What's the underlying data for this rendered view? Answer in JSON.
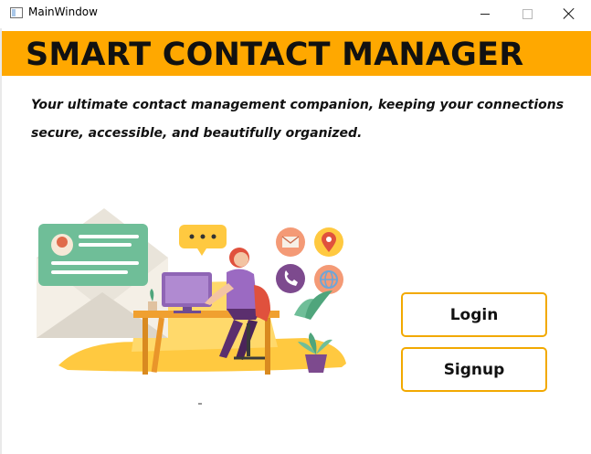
{
  "window": {
    "title": "MainWindow"
  },
  "banner": {
    "title": "SMART CONTACT MANAGER",
    "background_color": "#ffa800"
  },
  "tagline": "Your ultimate contact management companion, keeping your connections secure, accessible, and beautifully organized.",
  "buttons": {
    "login": "Login",
    "signup": "Signup",
    "border_color": "#f2a900"
  },
  "illustration": {
    "subject": "woman-at-computer-with-contact-icons",
    "icons": [
      "envelope-icon",
      "location-pin-icon",
      "phone-icon",
      "globe-icon",
      "chat-bubble-icon",
      "contact-card-icon"
    ]
  }
}
